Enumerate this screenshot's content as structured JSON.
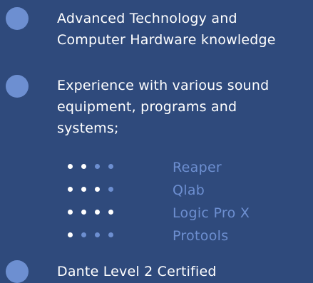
{
  "items": [
    {
      "lines": [
        "Advanced Technology and",
        "Computer Hardware knowledge"
      ]
    },
    {
      "lines": [
        "Experience with various sound",
        "equipment, programs and",
        "systems;"
      ]
    },
    {
      "lines": [
        "Dante Level 2 Certified"
      ]
    }
  ],
  "skills": [
    {
      "name": "Reaper",
      "level": 2,
      "max": 4
    },
    {
      "name": "Qlab",
      "level": 3,
      "max": 4
    },
    {
      "name": "Logic Pro X",
      "level": 4,
      "max": 4
    },
    {
      "name": "Protools",
      "level": 1,
      "max": 4
    }
  ],
  "colors": {
    "background": "#2f4a7c",
    "accent": "#6d8fd1",
    "text": "#ffffff",
    "skill_text": "#6d8fd1"
  }
}
